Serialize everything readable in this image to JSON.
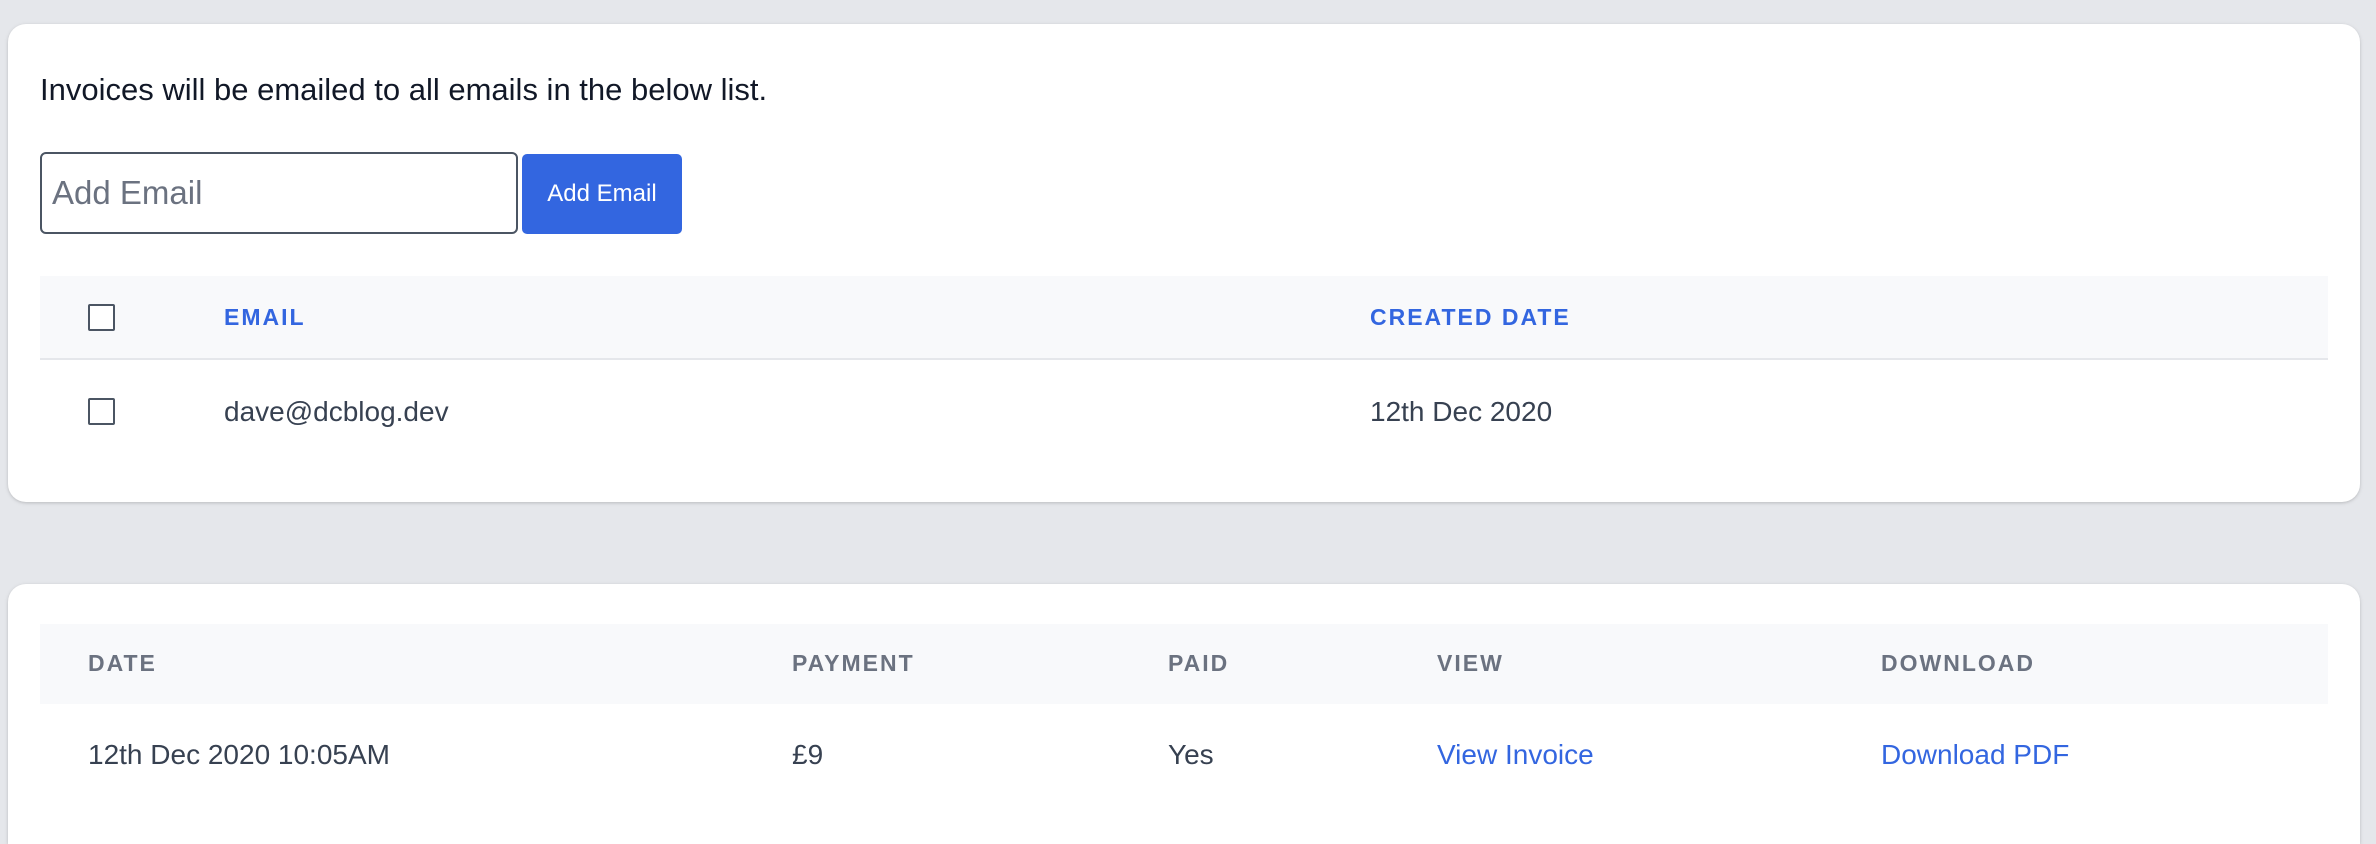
{
  "emails_section": {
    "intro_text": "Invoices will be emailed to all emails in the below list.",
    "input": {
      "value": "",
      "placeholder": "Add Email"
    },
    "add_button_label": "Add Email",
    "table": {
      "columns": [
        "EMAIL",
        "CREATED DATE"
      ],
      "rows": [
        {
          "email": "dave@dcblog.dev",
          "created_date": "12th Dec 2020",
          "selected": false
        }
      ]
    }
  },
  "invoices_section": {
    "table": {
      "columns": [
        "DATE",
        "PAYMENT",
        "PAID",
        "VIEW",
        "DOWNLOAD"
      ],
      "rows": [
        {
          "date": "12th Dec 2020 10:05AM",
          "payment": "£9",
          "paid": "Yes",
          "view_label": "View Invoice",
          "download_label": "Download PDF"
        }
      ]
    }
  },
  "colors": {
    "accent": "#3366e0",
    "page_background": "#e5e7eb",
    "card_background": "#ffffff",
    "table_header_background": "#f8f9fb"
  }
}
